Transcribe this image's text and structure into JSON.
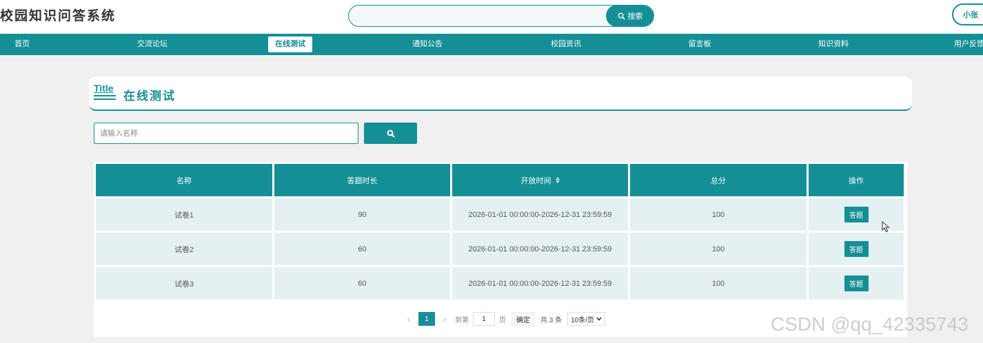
{
  "header": {
    "site_title": "校园知识问答系统",
    "search": {
      "placeholder": "",
      "button_label": "搜索"
    },
    "user_button": "小张"
  },
  "nav": {
    "items": [
      "首页",
      "交流论坛",
      "在线测试",
      "通知公告",
      "校园资讯",
      "留言板",
      "知识资料",
      "用户反馈"
    ],
    "active": "在线测试"
  },
  "page": {
    "title_icon_text": "Title",
    "title": "在线测试",
    "filter": {
      "name_placeholder": "请输入名称",
      "name_value": ""
    }
  },
  "table": {
    "columns": [
      "名称",
      "答题时长",
      "开放时间",
      "总分",
      "操作"
    ],
    "rows": [
      {
        "name": "试卷1",
        "duration": "90",
        "open_time": "2026-01-01 00:00:00-2026-12-31 23:59:59",
        "score": "100",
        "action": "答题"
      },
      {
        "name": "试卷2",
        "duration": "60",
        "open_time": "2026-01-01 00:00:00-2026-12-31 23:59:59",
        "score": "100",
        "action": "答题"
      },
      {
        "name": "试卷3",
        "duration": "60",
        "open_time": "2026-01-01 00:00:00-2026-12-31 23:59:59",
        "score": "100",
        "action": "答题"
      }
    ]
  },
  "pagination": {
    "current_page": "1",
    "goto_label": "到第",
    "goto_value": "1",
    "page_unit": "页",
    "confirm": "确定",
    "total": "共 3 条",
    "page_size": "10条/页"
  },
  "watermark": "CSDN @qq_42335743",
  "colors": {
    "primary": "#158f96",
    "cell_bg": "#e5f0f2",
    "page_bg": "#f0f0f0"
  }
}
